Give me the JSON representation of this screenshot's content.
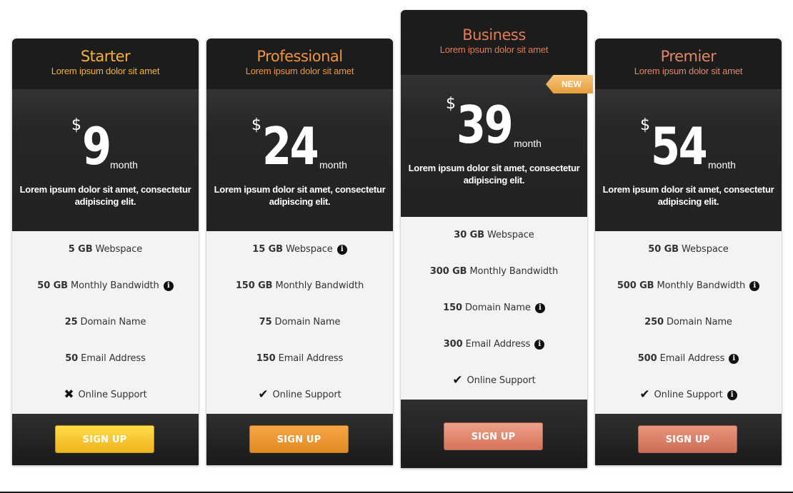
{
  "colors": {
    "starter": "#f5b13a",
    "professional": "#f0953e",
    "business": "#e37b55",
    "premier": "#e0876a",
    "btn_starter": [
      "#ffde4a",
      "#f0b21d"
    ],
    "btn_professional": [
      "#f6a648",
      "#e18a21"
    ],
    "btn_business": [
      "#eea18a",
      "#d8735a"
    ],
    "btn_premier": [
      "#e9967d",
      "#cc6d55"
    ]
  },
  "plans": [
    {
      "name": "Starter",
      "subtitle": "Lorem ipsum dolor sit amet",
      "currency": "$",
      "amount": "9",
      "period": "month",
      "description": "Lorem ipsum dolor sit amet, consectetur adipiscing elit.",
      "features": [
        {
          "value": "5 GB",
          "label": "Webspace",
          "icon": ""
        },
        {
          "value": "50 GB",
          "label": "Monthly Bandwidth",
          "icon": "info-icon"
        },
        {
          "value": "25",
          "label": "Domain Name",
          "icon": ""
        },
        {
          "value": "50",
          "label": "Email Address",
          "icon": ""
        },
        {
          "value": "",
          "label": "Online Support",
          "icon": "",
          "mark": "cross-icon"
        }
      ],
      "button": "SIGN UP"
    },
    {
      "name": "Professional",
      "subtitle": "Lorem ipsum dolor sit amet",
      "currency": "$",
      "amount": "24",
      "period": "month",
      "description": "Lorem ipsum dolor sit amet, consectetur adipiscing elit.",
      "features": [
        {
          "value": "15 GB",
          "label": "Webspace",
          "icon": "info-icon"
        },
        {
          "value": "150 GB",
          "label": "Monthly Bandwidth",
          "icon": ""
        },
        {
          "value": "75",
          "label": "Domain Name",
          "icon": ""
        },
        {
          "value": "150",
          "label": "Email Address",
          "icon": ""
        },
        {
          "value": "",
          "label": "Online Support",
          "icon": "",
          "mark": "check-icon"
        }
      ],
      "button": "SIGN UP"
    },
    {
      "name": "Business",
      "subtitle": "Lorem ipsum dolor sit amet",
      "currency": "$",
      "amount": "39",
      "period": "month",
      "description": "Lorem ipsum dolor sit amet, consectetur adipiscing elit.",
      "badge": "NEW",
      "features": [
        {
          "value": "30 GB",
          "label": "Webspace",
          "icon": ""
        },
        {
          "value": "300 GB",
          "label": "Monthly Bandwidth",
          "icon": ""
        },
        {
          "value": "150",
          "label": "Domain Name",
          "icon": "info-icon"
        },
        {
          "value": "300",
          "label": "Email Address",
          "icon": "info-icon"
        },
        {
          "value": "",
          "label": "Online Support",
          "icon": "",
          "mark": "check-icon"
        }
      ],
      "button": "SIGN UP"
    },
    {
      "name": "Premier",
      "subtitle": "Lorem ipsum dolor sit amet",
      "currency": "$",
      "amount": "54",
      "period": "month",
      "description": "Lorem ipsum dolor sit amet, consectetur adipiscing elit.",
      "features": [
        {
          "value": "50 GB",
          "label": "Webspace",
          "icon": ""
        },
        {
          "value": "500 GB",
          "label": "Monthly Bandwidth",
          "icon": "info-icon"
        },
        {
          "value": "250",
          "label": "Domain Name",
          "icon": ""
        },
        {
          "value": "500",
          "label": "Email Address",
          "icon": "info-icon"
        },
        {
          "value": "",
          "label": "Online Support",
          "icon": "info-icon",
          "mark": "check-icon"
        }
      ],
      "button": "SIGN UP"
    }
  ]
}
